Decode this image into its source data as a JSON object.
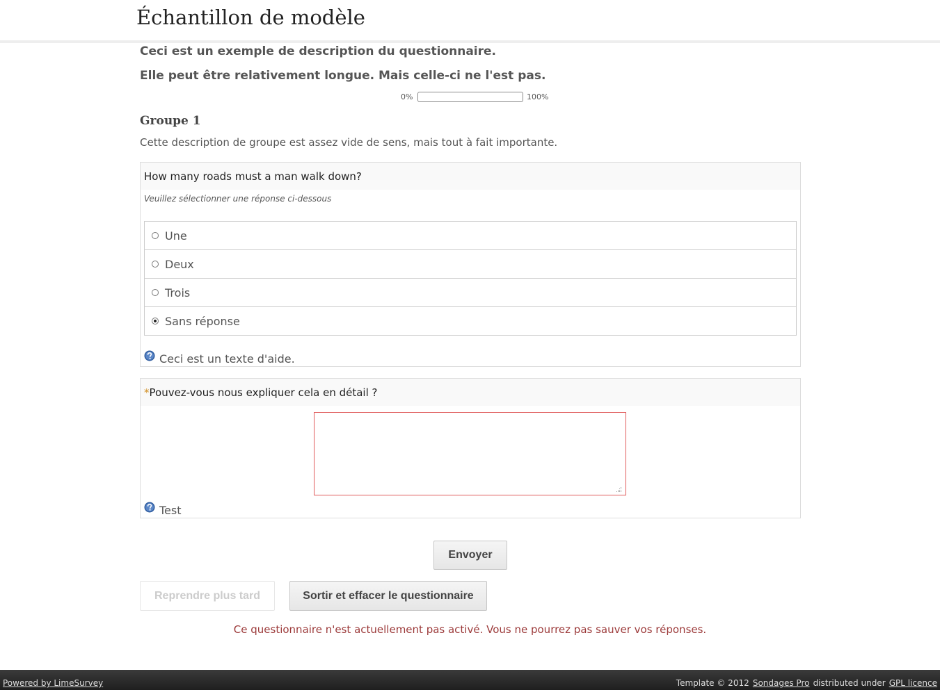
{
  "header": {
    "title": "Échantillon de modèle"
  },
  "survey": {
    "description_line1": "Ceci est un exemple de description du questionnaire.",
    "description_line2": "Elle peut être relativement longue. Mais celle-ci ne l'est pas."
  },
  "progress": {
    "start_label": "0%",
    "end_label": "100%",
    "value_percent": 0
  },
  "group": {
    "title": "Groupe 1",
    "description": "Cette description de groupe est assez vide de sens, mais tout à fait importante."
  },
  "question1": {
    "text": "How many roads must a man walk down?",
    "tip": "Veuillez sélectionner une réponse ci-dessous",
    "answers": [
      {
        "label": "Une",
        "selected": false
      },
      {
        "label": "Deux",
        "selected": false
      },
      {
        "label": "Trois",
        "selected": false
      },
      {
        "label": "Sans réponse",
        "selected": true
      }
    ],
    "help_icon": "question-circle-icon",
    "help_text": "Ceci est un texte d'aide."
  },
  "question2": {
    "required_mark": "*",
    "text": "Pouvez-vous nous expliquer cela en détail ?",
    "answer_value": "",
    "help_icon": "question-circle-icon",
    "help_text": "Test"
  },
  "buttons": {
    "submit_label": "Envoyer",
    "resume_later_label": "Reprendre plus tard",
    "exit_clear_label": "Sortir et effacer le questionnaire"
  },
  "warning": {
    "text": "Ce questionnaire n'est actuellement pas activé. Vous ne pourrez pas sauver vos réponses."
  },
  "footer": {
    "powered_by": "Powered by LimeSurvey",
    "template_prefix": "Template © 2012",
    "template_author": "Sondages Pro",
    "distributed_under": "distributed under",
    "licence": "GPL licence"
  },
  "colors": {
    "warning_text": "#9c3a3a",
    "required_mark": "#d29025",
    "invalid_border": "#e05a5a",
    "help_icon": "#2e5b9e",
    "footer_background": "#2b2b2b"
  }
}
